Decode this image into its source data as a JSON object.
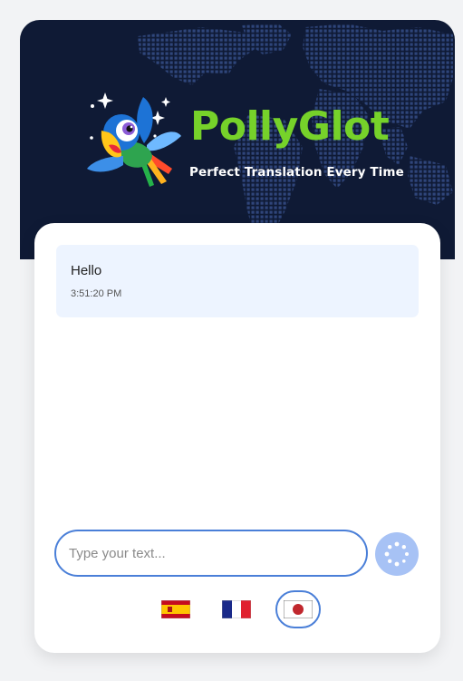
{
  "brand": {
    "name": "PollyGlot",
    "tagline": "Perfect Translation Every Time"
  },
  "messages": [
    {
      "text": "Hello",
      "time": "3:51:20 PM"
    }
  ],
  "input": {
    "placeholder": "Type your text..."
  },
  "send": {
    "icon": "spinner-icon",
    "state": "loading"
  },
  "languages": [
    {
      "name": "Spanish",
      "icon": "spain-flag-icon",
      "selected": false
    },
    {
      "name": "French",
      "icon": "france-flag-icon",
      "selected": false
    },
    {
      "name": "Japanese",
      "icon": "japan-flag-icon",
      "selected": true
    }
  ],
  "colors": {
    "header_bg": "#0f1a35",
    "brand_green": "#76d22a",
    "accent_blue": "#4a7fd8",
    "send_bg": "#a7c2f5",
    "message_bg": "#edf4ff"
  }
}
